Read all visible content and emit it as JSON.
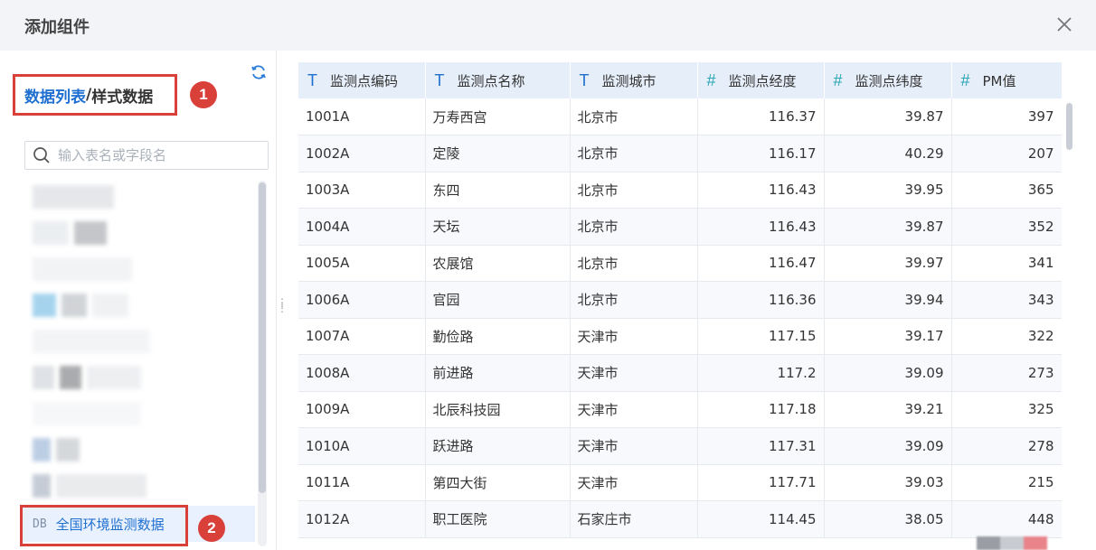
{
  "header": {
    "title": "添加组件"
  },
  "left_panel": {
    "title_link": "数据列表",
    "title_sep": "/",
    "title_rest": "样式数据",
    "badge1": "1",
    "badge2": "2",
    "search_placeholder": "输入表名或字段名",
    "active_item": {
      "tag": "DB",
      "label": "全国环境监测数据"
    }
  },
  "table": {
    "columns": [
      {
        "type": "T",
        "label": "监测点编码"
      },
      {
        "type": "T",
        "label": "监测点名称"
      },
      {
        "type": "T",
        "label": "监测城市"
      },
      {
        "type": "#",
        "label": "监测点经度"
      },
      {
        "type": "#",
        "label": "监测点纬度"
      },
      {
        "type": "#",
        "label": "PM值"
      }
    ],
    "rows": [
      [
        "1001A",
        "万寿西宫",
        "北京市",
        "116.37",
        "39.87",
        "397"
      ],
      [
        "1002A",
        "定陵",
        "北京市",
        "116.17",
        "40.29",
        "207"
      ],
      [
        "1003A",
        "东四",
        "北京市",
        "116.43",
        "39.95",
        "365"
      ],
      [
        "1004A",
        "天坛",
        "北京市",
        "116.43",
        "39.87",
        "352"
      ],
      [
        "1005A",
        "农展馆",
        "北京市",
        "116.47",
        "39.97",
        "341"
      ],
      [
        "1006A",
        "官园",
        "北京市",
        "116.36",
        "39.94",
        "343"
      ],
      [
        "1007A",
        "勤俭路",
        "天津市",
        "117.15",
        "39.17",
        "322"
      ],
      [
        "1008A",
        "前进路",
        "天津市",
        "117.2",
        "39.09",
        "273"
      ],
      [
        "1009A",
        "北辰科技园",
        "天津市",
        "117.18",
        "39.21",
        "325"
      ],
      [
        "1010A",
        "跃进路",
        "天津市",
        "117.31",
        "39.09",
        "278"
      ],
      [
        "1011A",
        "第四大街",
        "天津市",
        "117.71",
        "39.03",
        "215"
      ],
      [
        "1012A",
        "职工医院",
        "石家庄市",
        "114.45",
        "38.05",
        "448"
      ]
    ]
  },
  "colors": {
    "accent": "#1f6fd1",
    "annotation": "#d9403a",
    "header_bg": "#e5eef9",
    "numeric_type": "#2aa6b5"
  }
}
